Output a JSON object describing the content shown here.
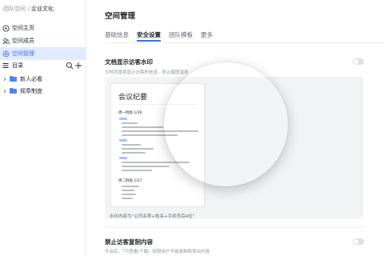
{
  "breadcrumb": {
    "root": "团队空间",
    "separator": "/",
    "current": "企业文化"
  },
  "nav": [
    {
      "label": "空间主页",
      "icon": "home-icon"
    },
    {
      "label": "空间成员",
      "icon": "members-icon"
    },
    {
      "label": "空间管理",
      "icon": "settings-icon",
      "active": true
    }
  ],
  "directory": {
    "label": "目录",
    "icons": [
      "search-icon",
      "add-icon"
    ]
  },
  "tree": [
    {
      "label": "新人必看",
      "icon": "folder-icon"
    },
    {
      "label": "规章制度",
      "icon": "folder-icon"
    }
  ],
  "main": {
    "title": "空间管理",
    "tabs": [
      {
        "label": "基础信息"
      },
      {
        "label": "安全设置",
        "active": true
      },
      {
        "label": "团队模板"
      },
      {
        "label": "更多"
      }
    ],
    "watermark": {
      "title": "文档显示访客水印",
      "desc": "文档背景将显示访客的信息，防止截图滥用",
      "enabled": false,
      "preview_doc_title": "会议纪要",
      "preview_heading_1": "周一例会 1/26",
      "preview_heading_2": "周二例会 1/27",
      "footnote": "水印内容为“公司名称+姓名+手机号后4位”"
    },
    "copy_protect": {
      "title": "禁止访客复制内容",
      "desc": "开启后，「可查看/下载」权限用户不能复制和导出内容",
      "enabled": false
    }
  },
  "colors": {
    "accent": "#3370ff",
    "active_bg": "#e1eaff",
    "folder": "#4e83fd"
  }
}
